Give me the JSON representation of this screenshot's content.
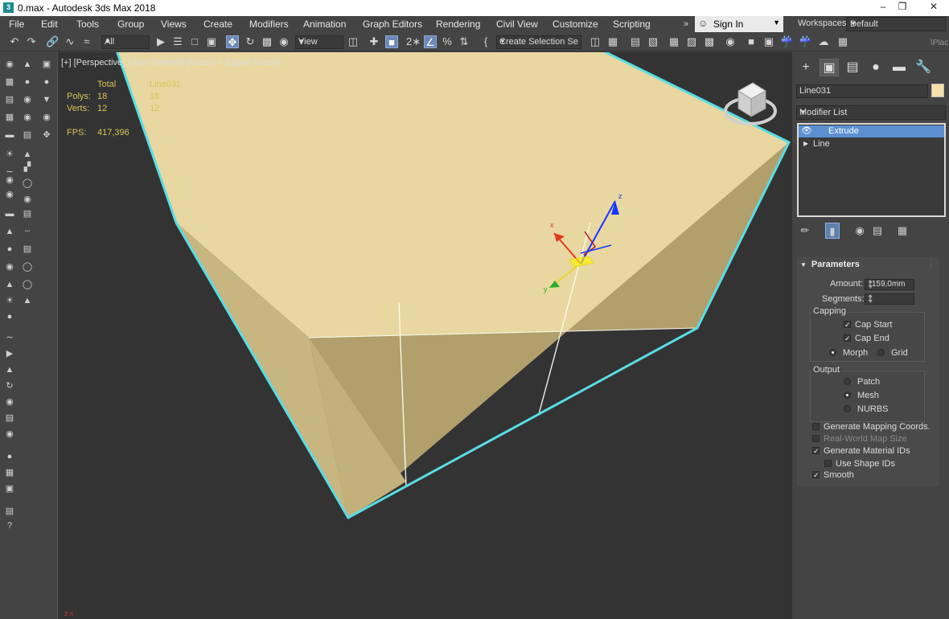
{
  "window": {
    "title": "0.max - Autodesk 3ds Max 2018",
    "app_icon": "3",
    "minimize": "–",
    "restore": "❐",
    "close": "✕"
  },
  "menu": [
    "File",
    "Edit",
    "Tools",
    "Group",
    "Views",
    "Create",
    "Modifiers",
    "Animation",
    "Graph Editors",
    "Rendering",
    "Civil View",
    "Customize",
    "Scripting"
  ],
  "menu_more": "»",
  "signin": {
    "label": "Sign In",
    "icon": "user-icon"
  },
  "workspaces": {
    "label": "Workspaces:",
    "value": "Default"
  },
  "toolbar": {
    "selection_filter": "All",
    "ref_coord": "View",
    "named_selection": "Create Selection Se",
    "cut_text": "\\Plac"
  },
  "viewport": {
    "label_plus": "[+]",
    "label_view": "[Perspective]",
    "label_shading_a": "[User Defined]",
    "label_shading_b": "[Facets + Edged Faces]",
    "stats": {
      "col_total": "Total",
      "col_object": "Line031",
      "polys_label": "Polys:",
      "polys_total": "18",
      "polys_object": "18",
      "verts_label": "Verts:",
      "verts_total": "12",
      "verts_object": "12",
      "fps_label": "FPS:",
      "fps_value": "417,396"
    },
    "gizmo_z": "z",
    "gizmo_y": "y",
    "gizmo_x": "x"
  },
  "command_panel": {
    "object_name": "Line031",
    "object_color": "#f5e2a8",
    "modifier_list": "Modifier List",
    "stack": [
      {
        "label": "Extrude",
        "selected": true
      },
      {
        "label": "Line",
        "selected": false
      }
    ]
  },
  "parameters": {
    "title": "Parameters",
    "amount_label": "Amount:",
    "amount_value": "1159,0mm",
    "segments_label": "Segments:",
    "segments_value": "1",
    "capping_title": "Capping",
    "cap_start": "Cap Start",
    "cap_end": "Cap End",
    "morph": "Morph",
    "grid": "Grid",
    "output_title": "Output",
    "patch": "Patch",
    "mesh": "Mesh",
    "nurbs": "NURBS",
    "gen_mapping": "Generate Mapping Coords.",
    "real_world": "Real-World Map Size",
    "gen_material": "Generate Material IDs",
    "use_shape": "Use Shape IDs",
    "smooth": "Smooth",
    "checks": {
      "cap_start": true,
      "cap_end": true,
      "gen_mapping": false,
      "real_world": false,
      "gen_material": true,
      "use_shape": false,
      "smooth": true
    },
    "capping_type": "Morph",
    "output_type": "Mesh"
  }
}
